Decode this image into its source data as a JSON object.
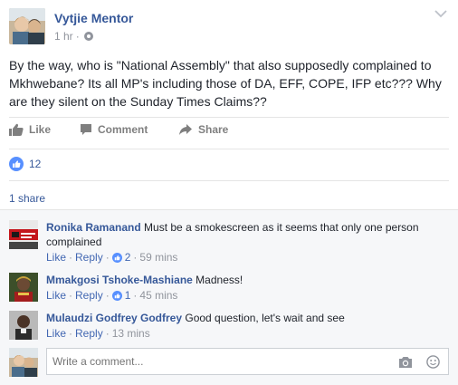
{
  "post": {
    "author": "Vytjie Mentor",
    "time": "1 hr",
    "separator": "·",
    "text": "By the way, who is \"National Assembly\" that also supposedly complained to Mkhwebane? Its all MP's including those of DA, EFF, COPE, IFP etc??? Why are they silent on the Sunday Times Claims??"
  },
  "actions": {
    "like": "Like",
    "comment": "Comment",
    "share": "Share"
  },
  "reactions": {
    "count": "12"
  },
  "shares": {
    "label": "1 share"
  },
  "comments": [
    {
      "author": "Ronika Ramanand",
      "text": "Must be a smokescreen as it seems that only one person complained",
      "like_label": "Like",
      "reply_label": "Reply",
      "likes": "2",
      "time": "59 mins",
      "dot": "·"
    },
    {
      "author": "Mmakgosi Tshoke-Mashiane",
      "text": "Madness!",
      "like_label": "Like",
      "reply_label": "Reply",
      "likes": "1",
      "time": "45 mins",
      "dot": "·"
    },
    {
      "author": "Mulaudzi Godfrey Godfrey",
      "text": "Good question, let's wait and see",
      "like_label": "Like",
      "reply_label": "Reply",
      "time": "13 mins",
      "dot": "·"
    }
  ],
  "composer": {
    "placeholder": "Write a comment..."
  },
  "colors": {
    "link": "#365899",
    "accent": "#4267b2",
    "muted": "#90949c",
    "background_comments": "#f6f7f9"
  },
  "icons": [
    "globe-icon",
    "chevron-down-icon",
    "like-icon",
    "comment-icon",
    "share-icon",
    "like-badge-icon",
    "camera-icon",
    "emoji-icon"
  ]
}
